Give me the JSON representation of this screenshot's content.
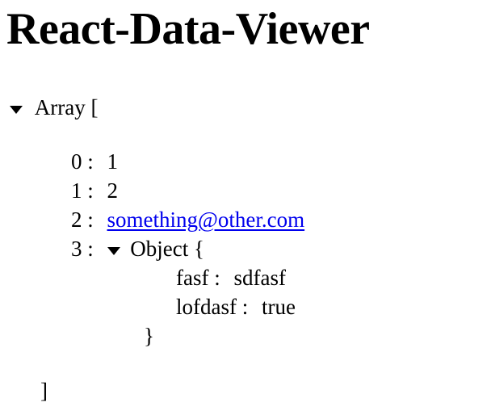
{
  "header": {
    "title": "React-Data-Viewer"
  },
  "viewer": {
    "root": {
      "type_label": "Array [",
      "close_label": "]",
      "items": [
        {
          "key": "0 :",
          "value": "1"
        },
        {
          "key": "1 :",
          "value": "2"
        },
        {
          "key": "2 :",
          "value": "something@other.com"
        },
        {
          "key": "3 :",
          "object": {
            "type_label": "Object {",
            "close_label": "}",
            "entries": [
              {
                "key": "fasf :",
                "value": "sdfasf"
              },
              {
                "key": "lofdasf :",
                "value": "true"
              }
            ]
          }
        }
      ]
    }
  },
  "icons": {
    "expand": "caret-down-icon"
  },
  "colors": {
    "link": "#0000ee",
    "text": "#000000",
    "background": "#ffffff"
  }
}
